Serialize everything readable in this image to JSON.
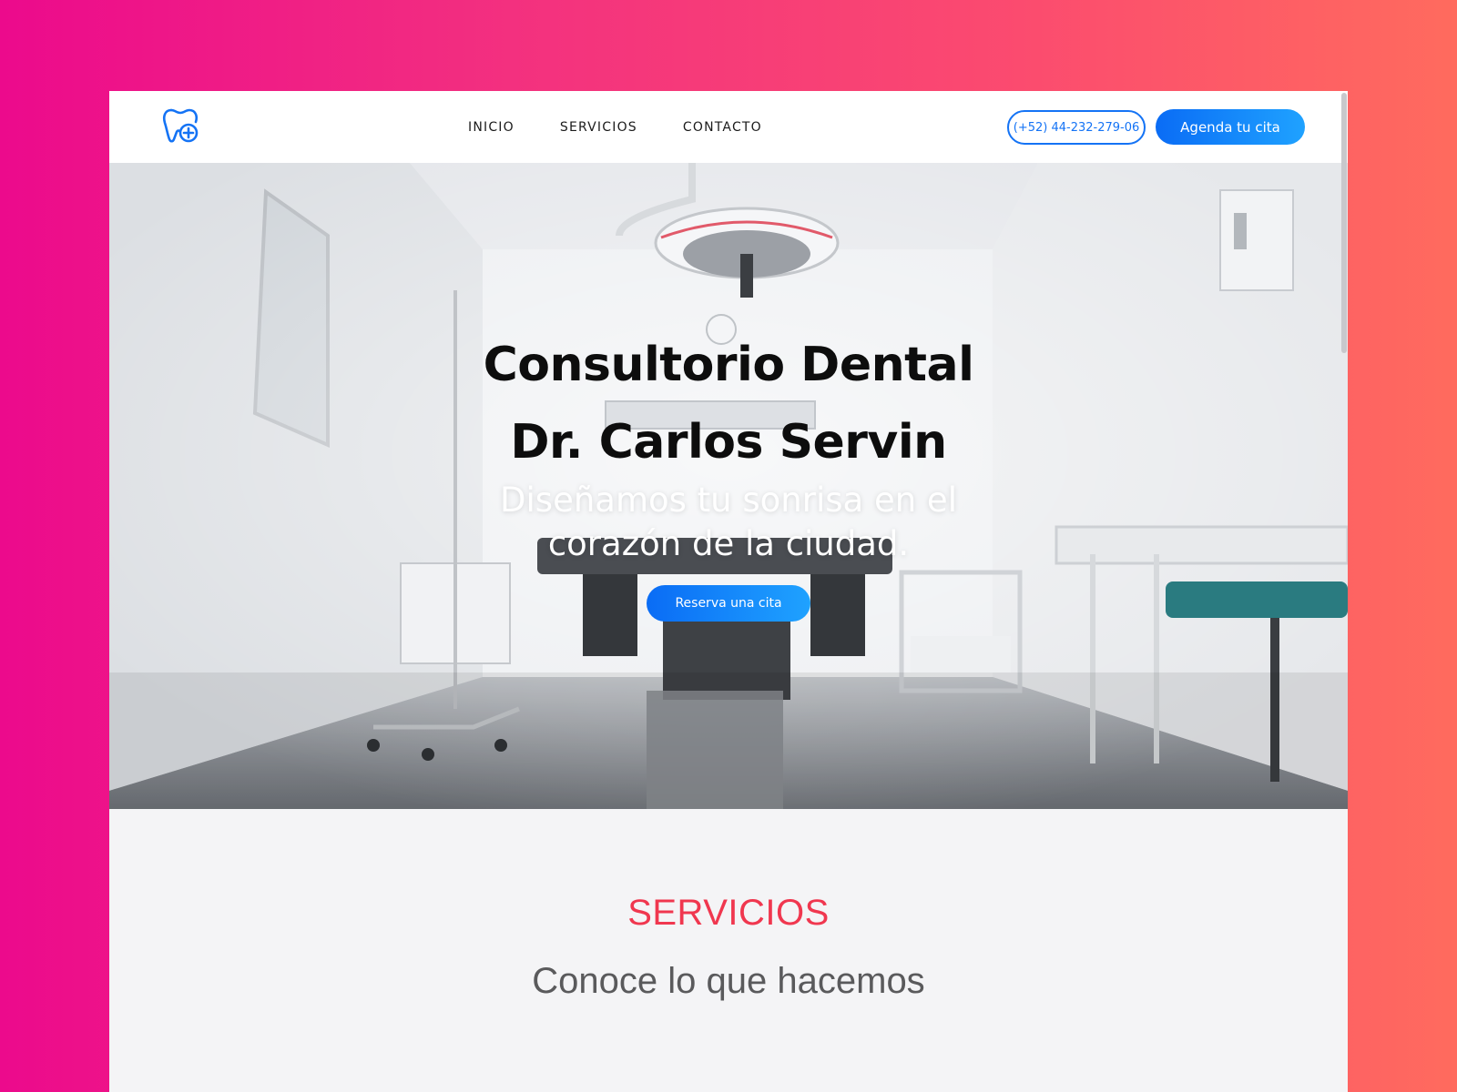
{
  "nav": {
    "logo_icon": "tooth-plus-icon",
    "links": [
      {
        "label": "INICIO"
      },
      {
        "label": "SERVICIOS"
      },
      {
        "label": "CONTACTO"
      }
    ],
    "phone": "(+52) 44-232-279-06",
    "cta": "Agenda tu cita"
  },
  "hero": {
    "title_line1": "Consultorio Dental",
    "title_line2": "Dr. Carlos Servin",
    "subtitle_line1": "Diseñamos tu sonrisa en el",
    "subtitle_line2": "corazón de la ciudad.",
    "button": "Reserva una cita"
  },
  "services": {
    "heading": "SERVICIOS",
    "subheading": "Conoce lo que hacemos"
  },
  "colors": {
    "accent_blue": "#1473f5",
    "accent_red": "#f0374f",
    "bg_gradient_start": "#ec0a8c",
    "bg_gradient_end": "#ff6b5e"
  }
}
